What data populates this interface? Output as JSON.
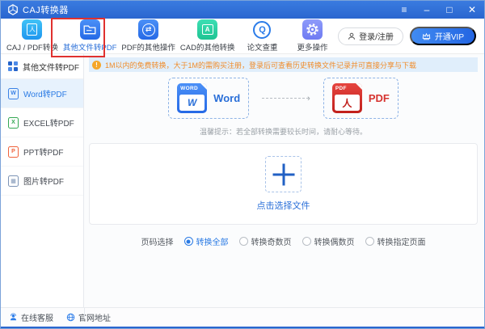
{
  "window": {
    "title": "CAJ转换器",
    "controls": {
      "menu": "menu-icon",
      "minimize": "minimize-icon",
      "maximize": "maximize-icon",
      "close": "close-icon"
    }
  },
  "toolbar": {
    "items": [
      {
        "label": "CAJ / PDF转换",
        "icon": "caj-pdf-icon",
        "active": false
      },
      {
        "label": "其他文件转PDF",
        "icon": "folder-icon",
        "active": true,
        "highlighted": true
      },
      {
        "label": "PDF的其他操作",
        "icon": "swap-circle-icon",
        "active": false
      },
      {
        "label": "CAD的其他转换",
        "icon": "cad-icon",
        "active": false
      },
      {
        "label": "论文查重",
        "icon": "paper-check-icon",
        "active": false
      },
      {
        "label": "更多操作",
        "icon": "gear-icon",
        "active": false
      }
    ],
    "login_label": "登录/注册",
    "vip_label": "开通VIP"
  },
  "sidebar": {
    "header": "其他文件转PDF",
    "items": [
      {
        "label": "Word转PDF",
        "icon": "word-doc-icon",
        "letter": "W",
        "active": true
      },
      {
        "label": "EXCEL转PDF",
        "icon": "excel-doc-icon",
        "letter": "X",
        "active": false
      },
      {
        "label": "PPT转PDF",
        "icon": "ppt-doc-icon",
        "letter": "P",
        "active": false
      },
      {
        "label": "图片转PDF",
        "icon": "image-doc-icon",
        "letter": "▦",
        "active": false
      }
    ]
  },
  "main": {
    "notice": "1M以内的免费转换，大于1M的需购买注册，登录后可查看历史转换文件记录并可直接分享与下载",
    "notice_mark": "!",
    "source_format": {
      "badge": "WORD",
      "letter": "W",
      "label": "Word"
    },
    "target_format": {
      "badge": "PDF",
      "glyph": "人",
      "label": "PDF"
    },
    "arrow": "›",
    "tip": "温馨提示：若全部转换需要较长时间，请耐心等待。",
    "select_file_label": "点击选择文件",
    "page_select": {
      "label": "页码选择",
      "options": [
        {
          "label": "转换全部",
          "selected": true
        },
        {
          "label": "转换奇数页",
          "selected": false
        },
        {
          "label": "转换偶数页",
          "selected": false
        },
        {
          "label": "转换指定页面",
          "selected": false
        }
      ]
    }
  },
  "statusbar": {
    "items": [
      {
        "label": "在线客服",
        "icon": "support-agent-icon"
      },
      {
        "label": "官网地址",
        "icon": "globe-icon"
      }
    ]
  },
  "colors": {
    "titlebar_blue": "#2f6fd8",
    "accent_blue": "#2a7ae4",
    "highlight_red": "#e0312f",
    "notice_orange": "#f08c2a",
    "pdf_red": "#d6332f",
    "cad_teal": "#2fd0a6",
    "gear_purple": "#7b87f8"
  }
}
